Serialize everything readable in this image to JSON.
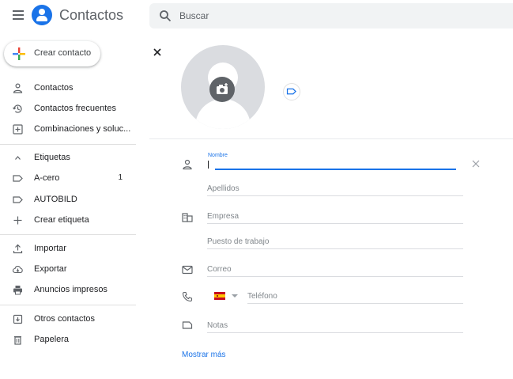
{
  "header": {
    "app_title": "Contactos",
    "search_placeholder": "Buscar"
  },
  "sidebar": {
    "create_label": "Crear contacto",
    "items": [
      {
        "label": "Contactos",
        "icon": "person-icon"
      },
      {
        "label": "Contactos frecuentes",
        "icon": "history-icon"
      },
      {
        "label": "Combinaciones y soluc...",
        "icon": "merge-icon"
      }
    ],
    "labels_header": "Etiquetas",
    "labels": [
      {
        "label": "A-cero",
        "count": "1",
        "icon": "label-icon"
      },
      {
        "label": "AUTOBILD",
        "count": "",
        "icon": "label-icon"
      },
      {
        "label": "Crear etiqueta",
        "count": "",
        "icon": "plus-icon"
      }
    ],
    "tools": [
      {
        "label": "Importar",
        "icon": "upload-icon"
      },
      {
        "label": "Exportar",
        "icon": "cloud-download-icon"
      },
      {
        "label": "Anuncios impresos",
        "icon": "print-icon"
      }
    ],
    "other": [
      {
        "label": "Otros contactos",
        "icon": "archive-icon"
      },
      {
        "label": "Papelera",
        "icon": "trash-icon"
      }
    ]
  },
  "form": {
    "name_label": "Nombre",
    "name_value": "",
    "lastname_placeholder": "Apellidos",
    "company_placeholder": "Empresa",
    "jobtitle_placeholder": "Puesto de trabajo",
    "email_placeholder": "Correo",
    "phone_placeholder": "Teléfono",
    "phone_country": "ES",
    "notes_placeholder": "Notas",
    "show_more": "Mostrar más"
  },
  "colors": {
    "accent": "#1a73e8",
    "icon_gray": "#5f6368"
  }
}
